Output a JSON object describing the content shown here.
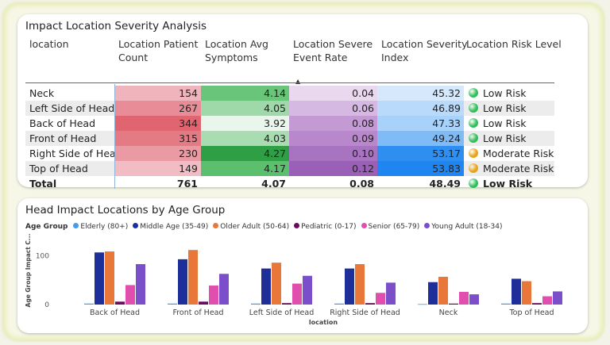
{
  "table": {
    "title": "Impact Location Severity Analysis",
    "headers": [
      {
        "line1": "location",
        "line2": ""
      },
      {
        "line1": "Location Patient",
        "line2": "Count"
      },
      {
        "line1": "Location Avg",
        "line2": "Symptoms"
      },
      {
        "line1": "Location Severe",
        "line2": "Event Rate"
      },
      {
        "line1": "Location Severity",
        "line2": "Index"
      },
      {
        "line1": "Location Risk Level",
        "line2": ""
      }
    ],
    "sort_indicator": "▲",
    "rows": [
      {
        "location": "Neck",
        "count": "154",
        "symptoms": "4.14",
        "severe_rate": "0.04",
        "index": "45.32",
        "risk": "Low Risk",
        "risk_color": "#2fbf5a",
        "count_bg": "#f0b4bd",
        "symptoms_bg": "#68c57a",
        "severe_bg": "#ead8ee",
        "index_bg": "#d6e9fc"
      },
      {
        "location": "Left Side of Head",
        "count": "267",
        "symptoms": "4.05",
        "severe_rate": "0.06",
        "index": "46.89",
        "risk": "Low Risk",
        "risk_color": "#2fbf5a",
        "count_bg": "#e88d97",
        "symptoms_bg": "#9fd9a9",
        "severe_bg": "#d6b9e2",
        "index_bg": "#b9dafb"
      },
      {
        "location": "Back of Head",
        "count": "344",
        "symptoms": "3.92",
        "severe_rate": "0.08",
        "index": "47.33",
        "risk": "Low Risk",
        "risk_color": "#2fbf5a",
        "count_bg": "#e16570",
        "symptoms_bg": "#eaf6ec",
        "severe_bg": "#c39ad4",
        "index_bg": "#a9d2fa"
      },
      {
        "location": "Front of Head",
        "count": "315",
        "symptoms": "4.03",
        "severe_rate": "0.09",
        "index": "49.24",
        "risk": "Low Risk",
        "risk_color": "#2fbf5a",
        "count_bg": "#e47a84",
        "symptoms_bg": "#aadcb2",
        "severe_bg": "#b988cc",
        "index_bg": "#7fbbf6"
      },
      {
        "location": "Right Side of Head",
        "count": "230",
        "symptoms": "4.27",
        "severe_rate": "0.10",
        "index": "53.17",
        "risk": "Moderate Risk",
        "risk_color": "#e8a317",
        "count_bg": "#ea9aa3",
        "symptoms_bg": "#2f9f45",
        "severe_bg": "#a874c1",
        "index_bg": "#2f8ff0"
      },
      {
        "location": "Top of Head",
        "count": "149",
        "symptoms": "4.17",
        "severe_rate": "0.12",
        "index": "53.83",
        "risk": "Moderate Risk",
        "risk_color": "#e8a317",
        "count_bg": "#f2bcc4",
        "symptoms_bg": "#5cbf6e",
        "severe_bg": "#9a5fb7",
        "index_bg": "#1f85f0"
      }
    ],
    "total": {
      "location": "Total",
      "count": "761",
      "symptoms": "4.07",
      "severe_rate": "0.08",
      "index": "48.49",
      "risk": "Low Risk",
      "risk_color": "#2fbf5a"
    }
  },
  "chart": {
    "title": "Head Impact Locations by Age Group",
    "legend_title": "Age Group"
  },
  "chart_data": {
    "type": "bar",
    "title": "Head Impact Locations by Age Group",
    "xlabel": "location",
    "ylabel": "Age Group Impact C...",
    "ylim": [
      0,
      140
    ],
    "yticks": [
      "0",
      "100"
    ],
    "legend_position": "top-left",
    "categories": [
      "Back of Head",
      "Front of Head",
      "Left Side of Head",
      "Right Side of Head",
      "Neck",
      "Top of Head"
    ],
    "series": [
      {
        "name": "Elderly (80+)",
        "color": "#3f9cf0",
        "values": [
          2,
          2,
          2,
          2,
          1,
          2
        ]
      },
      {
        "name": "Middle Age (35-49)",
        "color": "#1f2f9a",
        "values": [
          107,
          93,
          74,
          74,
          46,
          53
        ]
      },
      {
        "name": "Older Adult (50-64)",
        "color": "#e9773a",
        "values": [
          109,
          112,
          86,
          83,
          57,
          48
        ]
      },
      {
        "name": "Pediatric (0-17)",
        "color": "#6b0a5e",
        "values": [
          6,
          6,
          3,
          3,
          2,
          3
        ]
      },
      {
        "name": "Senior (65-79)",
        "color": "#e04eae",
        "values": [
          40,
          39,
          43,
          24,
          26,
          17
        ]
      },
      {
        "name": "Young Adult (18-34)",
        "color": "#7b4fc9",
        "values": [
          83,
          63,
          59,
          45,
          21,
          27
        ]
      }
    ]
  }
}
